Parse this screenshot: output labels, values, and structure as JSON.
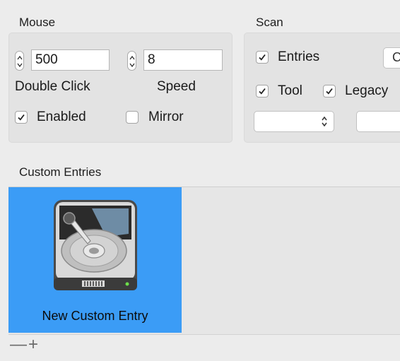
{
  "mouse": {
    "title": "Mouse",
    "double_click_value": "500",
    "double_click_label": "Double Click",
    "speed_value": "8",
    "speed_label": "Speed",
    "enabled_label": "Enabled",
    "enabled_checked": true,
    "mirror_label": "Mirror",
    "mirror_checked": false
  },
  "scan": {
    "title": "Scan",
    "entries_label": "Entries",
    "entries_checked": true,
    "tool_label": "Tool",
    "tool_checked": true,
    "legacy_label": "Legacy",
    "legacy_checked": true,
    "cut_button_label": "C",
    "popup_value": ""
  },
  "custom_entries": {
    "title": "Custom Entries",
    "items": [
      {
        "label": "New Custom Entry",
        "icon": "hard-drive-icon",
        "selected": true
      }
    ],
    "remove_label": "—",
    "add_label": "+"
  },
  "colors": {
    "selection": "#3b9cf6",
    "window_bg": "#ececec"
  }
}
